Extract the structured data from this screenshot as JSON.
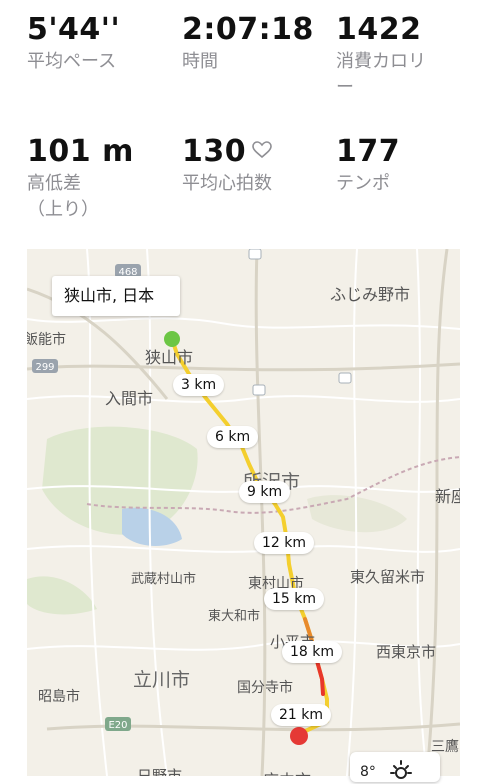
{
  "stats": {
    "pace": {
      "value": "5'44''",
      "label": "平均ペース"
    },
    "time": {
      "value": "2:07:18",
      "label": "時間"
    },
    "calories": {
      "value": "1422",
      "label": "消費カロリ",
      "label2": "ー"
    },
    "elevation": {
      "value": "101 m",
      "label": "高低差",
      "label2": "（上り）"
    },
    "heart_rate": {
      "value": "130",
      "label": "平均心拍数"
    },
    "cadence": {
      "value": "177",
      "label": "テンポ"
    }
  },
  "map": {
    "callout": "狭山市, 日本",
    "km_markers": [
      "3 km",
      "6 km",
      "9 km",
      "12 km",
      "15 km",
      "18 km",
      "21 km"
    ],
    "places": {
      "fujimino": "ふじみ野市",
      "sayama": "狭山市",
      "iruma": "入間市",
      "tokorozawa": "所沢市",
      "nii": "新座",
      "musashimurayama": "武蔵村山市",
      "higashiyamato": "東大和市",
      "higashimurayama": "東村山市",
      "higashikurume": "東久留米市",
      "kodaira": "小平市",
      "nishitokyo": "西東京市",
      "tachikawa": "立川市",
      "kokubunji": "国分寺市",
      "akishima": "昭島市",
      "hino": "日野市",
      "fuchu": "府中市",
      "mitaka": "三鷹",
      "hanno": "飯能市"
    },
    "road_labels": {
      "r468": "468",
      "r299": "299",
      "e20": "E20"
    },
    "weather": {
      "temp": "8°"
    },
    "colors": {
      "route_slow": "#e8372b",
      "route_mid": "#f4cf2e",
      "start": "#6cc644",
      "end": "#e53935"
    }
  }
}
